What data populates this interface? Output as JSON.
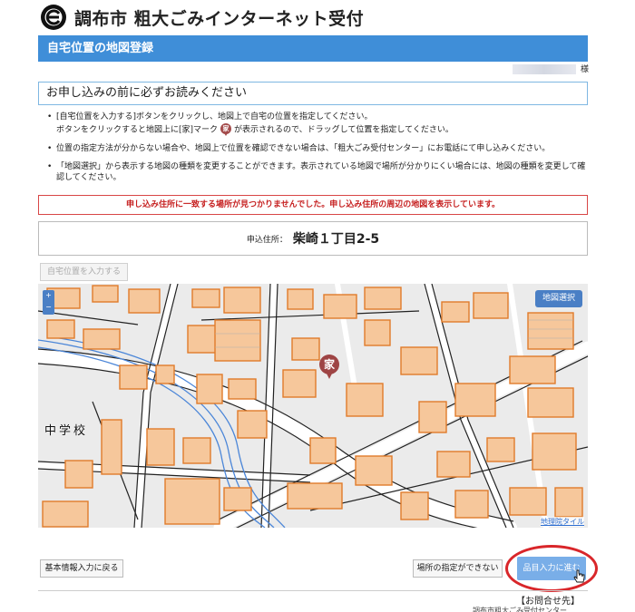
{
  "header": {
    "site_title": "調布市 粗大ごみインターネット受付",
    "page_title": "自宅位置の地図登録"
  },
  "user": {
    "suffix": "様"
  },
  "notice": {
    "title": "お申し込みの前に必ずお読みください",
    "items": [
      {
        "line1": "[自宅位置を入力する]ボタンをクリックし、地図上で自宅の位置を指定してください。",
        "line2_pre": "ボタンをクリックすると地図上に[家]マーク",
        "line2_post": "が表示されるので、ドラッグして位置を指定してください。"
      },
      "位置の指定方法が分からない場合や、地図上で位置を確認できない場合は、「粗大ごみ受付センター」にお電話にて申し込みください。",
      "「地図選択」から表示する地図の種類を変更することができます。表示されている地図で場所が分かりにくい場合には、地図の種類を変更して確認してください。"
    ],
    "marker_char": "家"
  },
  "error_message": "申し込み住所に一致する場所が見つかりませんでした。申し込み住所の周辺の地図を表示しています。",
  "address": {
    "label": "申込住所：",
    "value": "柴崎１丁目2-5"
  },
  "buttons": {
    "set_home": "自宅位置を入力する",
    "back": "基本情報入力に戻る",
    "cannot_specify": "場所の指定ができない",
    "next": "品目入力に進む"
  },
  "map": {
    "zoom_in": "+",
    "zoom_out": "−",
    "select_button": "地図選択",
    "home_marker": "家",
    "place_label": "中学校",
    "attribution": "地理院タイル"
  },
  "footer": {
    "contact_title": "【お問合せ先】",
    "contact_sub": "調布市粗大ごみ受付センター"
  },
  "colors": {
    "header_bg": "#3f8ed8",
    "error_red": "#c62020",
    "next_button": "#79aee8",
    "highlight_ring": "#d9262a",
    "building": "#f6c79b",
    "building_edge": "#e07b2a",
    "river": "#4b86d8"
  }
}
